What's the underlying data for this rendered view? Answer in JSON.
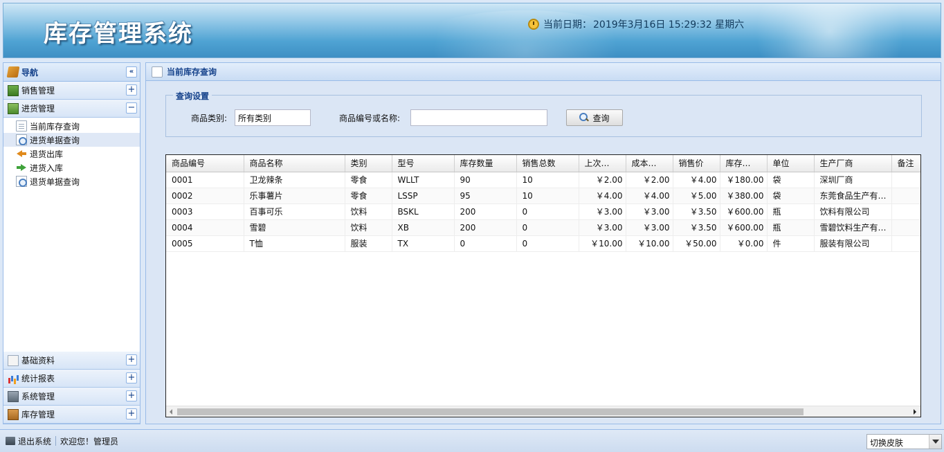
{
  "header": {
    "app_title": "库存管理系统",
    "clock_label": "当前日期：",
    "clock_value": "2019年3月16日 15:29:32 星期六"
  },
  "nav": {
    "title": "导航",
    "collapse_label": "«",
    "sections_top": [
      {
        "label": "销售管理",
        "icon": "sales-icon",
        "toggle": "+"
      },
      {
        "label": "进货管理",
        "icon": "purchase-icon",
        "toggle": "−"
      }
    ],
    "sub_items": [
      {
        "label": "当前库存查询",
        "icon": "document-icon"
      },
      {
        "label": "进货单据查询",
        "icon": "search-document-icon"
      },
      {
        "label": "退货出库",
        "icon": "return-out-icon"
      },
      {
        "label": "进货入库",
        "icon": "stock-in-icon"
      },
      {
        "label": "退货单据查询",
        "icon": "search-document-icon"
      }
    ],
    "sections_bottom": [
      {
        "label": "基础资料",
        "icon": "base-data-icon",
        "toggle": "+"
      },
      {
        "label": "统计报表",
        "icon": "chart-icon",
        "toggle": "+"
      },
      {
        "label": "系统管理",
        "icon": "system-icon",
        "toggle": "+"
      },
      {
        "label": "库存管理",
        "icon": "stock-box-icon",
        "toggle": "+"
      }
    ]
  },
  "main": {
    "title": "当前库存查询",
    "query": {
      "legend": "查询设置",
      "category_label": "商品类别:",
      "category_value": "所有类别",
      "code_label": "商品编号或名称:",
      "code_value": "",
      "search_button": "查询"
    },
    "grid": {
      "columns": [
        "商品编号",
        "商品名称",
        "类别",
        "型号",
        "库存数量",
        "销售总数",
        "上次…",
        "成本…",
        "销售价",
        "库存…",
        "单位",
        "生产厂商",
        "备注"
      ],
      "rows": [
        [
          "0001",
          "卫龙辣条",
          "零食",
          "WLLT",
          "90",
          "10",
          "￥2.00",
          "￥2.00",
          "￥4.00",
          "￥180.00",
          "袋",
          "深圳厂商",
          ""
        ],
        [
          "0002",
          "乐事薯片",
          "零食",
          "LSSP",
          "95",
          "10",
          "￥4.00",
          "￥4.00",
          "￥5.00",
          "￥380.00",
          "袋",
          "东莞食品生产有…",
          ""
        ],
        [
          "0003",
          "百事可乐",
          "饮料",
          "BSKL",
          "200",
          "0",
          "￥3.00",
          "￥3.00",
          "￥3.50",
          "￥600.00",
          "瓶",
          "饮料有限公司",
          ""
        ],
        [
          "0004",
          "雪碧",
          "饮料",
          "XB",
          "200",
          "0",
          "￥3.00",
          "￥3.00",
          "￥3.50",
          "￥600.00",
          "瓶",
          "雪碧饮料生产有…",
          ""
        ],
        [
          "0005",
          "T恤",
          "服装",
          "TX",
          "0",
          "0",
          "￥10.00",
          "￥10.00",
          "￥50.00",
          "￥0.00",
          "件",
          "服装有限公司",
          ""
        ]
      ]
    }
  },
  "status": {
    "logout_label": "退出系统",
    "welcome": "欢迎您！管理员",
    "skin_select": "切换皮肤"
  }
}
